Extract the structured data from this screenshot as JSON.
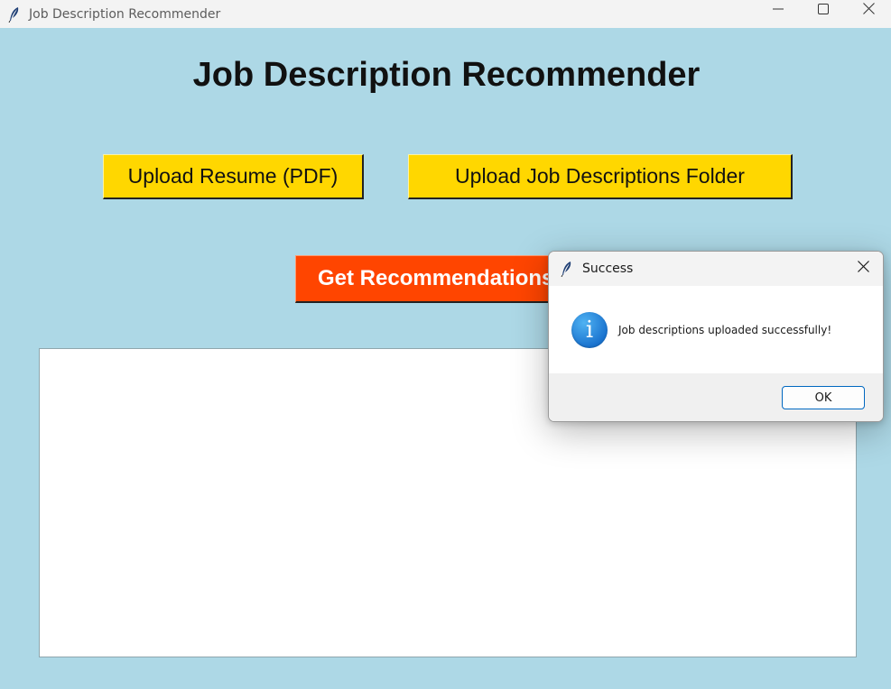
{
  "window": {
    "title": "Job Description Recommender",
    "icon": "feather-icon"
  },
  "main": {
    "heading": "Job Description Recommender",
    "upload_resume_label": "Upload Resume (PDF)",
    "upload_jd_label": "Upload Job Descriptions Folder",
    "get_recommendations_label": "Get Recommendations",
    "results_text": ""
  },
  "dialog": {
    "title": "Success",
    "icon": "information-icon",
    "message": "Job descriptions uploaded successfully!",
    "ok_label": "OK"
  },
  "colors": {
    "background": "#add8e6",
    "yellow_button": "#ffd700",
    "orange_button": "#ff4500",
    "dialog_accent": "#0067c0"
  }
}
